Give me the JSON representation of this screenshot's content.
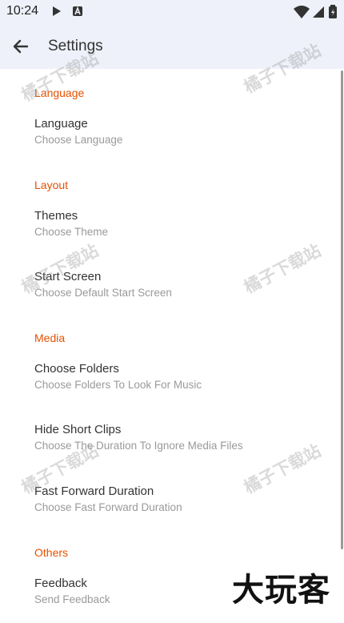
{
  "status_bar": {
    "time": "10:24"
  },
  "app_bar": {
    "title": "Settings"
  },
  "sections": [
    {
      "label": "Language"
    },
    {
      "label": "Layout"
    },
    {
      "label": "Media"
    },
    {
      "label": "Others"
    }
  ],
  "items": [
    {
      "title": "Language",
      "subtitle": "Choose Language"
    },
    {
      "title": "Themes",
      "subtitle": "Choose Theme"
    },
    {
      "title": "Start Screen",
      "subtitle": "Choose Default Start Screen"
    },
    {
      "title": "Choose Folders",
      "subtitle": "Choose Folders To Look For Music"
    },
    {
      "title": "Hide Short Clips",
      "subtitle": "Choose The Duration To Ignore Media Files"
    },
    {
      "title": "Fast Forward Duration",
      "subtitle": "Choose Fast Forward Duration"
    },
    {
      "title": "Feedback",
      "subtitle": "Send Feedback"
    }
  ],
  "watermark": {
    "text": "橘子下载站"
  },
  "corner_logo": {
    "text": "大玩客"
  },
  "colors": {
    "accent": "#e65100",
    "appbar": "#eef1f9"
  }
}
